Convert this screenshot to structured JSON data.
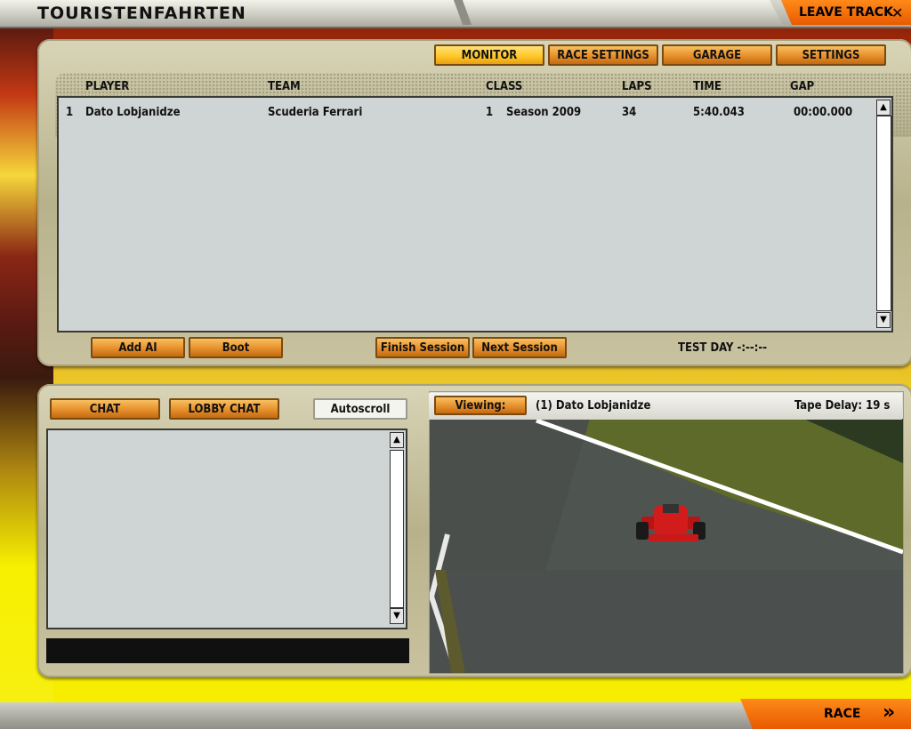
{
  "app_title": "TOURISTENFAHRTEN",
  "leave_track": "LEAVE TRACK",
  "close_glyph": "✕",
  "tabs": {
    "monitor": "MONITOR",
    "race_settings": "RACE SETTINGS",
    "garage": "GARAGE",
    "settings": "SETTINGS"
  },
  "table": {
    "headers": {
      "player": "PLAYER",
      "team": "TEAM",
      "class": "CLASS",
      "laps": "LAPS",
      "time": "TIME",
      "gap": "GAP"
    },
    "rows": [
      {
        "pos": "1",
        "player": "Dato Lobjanidze",
        "team": "Scuderia Ferrari",
        "class_num": "1",
        "class": "Season 2009",
        "laps": "34",
        "time": "5:40.043",
        "gap": "00:00.000"
      }
    ]
  },
  "session_buttons": {
    "add_ai": "Add AI",
    "boot": "Boot",
    "finish_session": "Finish Session",
    "next_session": "Next Session"
  },
  "session_status": "TEST DAY  -:--:--",
  "chat": {
    "chat": "CHAT",
    "lobby_chat": "LOBBY CHAT",
    "autoscroll": "Autoscroll"
  },
  "viewer": {
    "viewing_label": "Viewing:",
    "viewing_driver": "(1) Dato Lobjanidze",
    "tape_delay": "Tape Delay: 19 s"
  },
  "race": "RACE",
  "race_glyph": "»",
  "scroll_up": "▲",
  "scroll_down": "▼"
}
